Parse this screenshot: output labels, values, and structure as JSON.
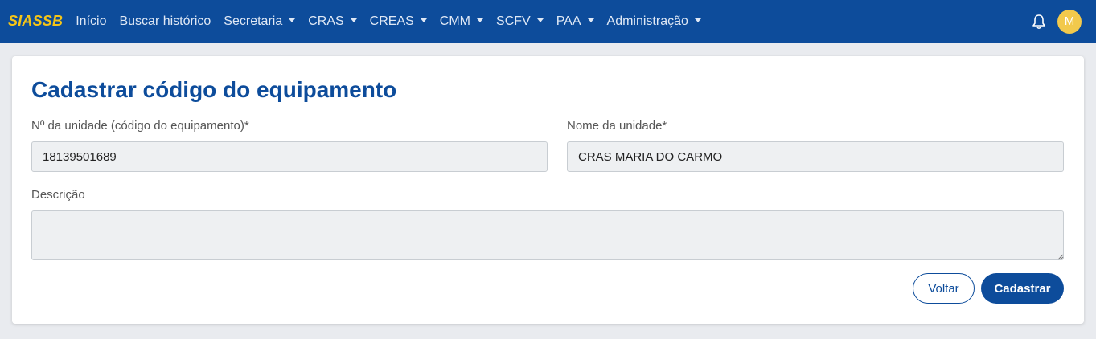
{
  "navbar": {
    "brand": "SIASSB",
    "items": [
      {
        "label": "Início",
        "dropdown": false
      },
      {
        "label": "Buscar histórico",
        "dropdown": false
      },
      {
        "label": "Secretaria",
        "dropdown": true
      },
      {
        "label": "CRAS",
        "dropdown": true
      },
      {
        "label": "CREAS",
        "dropdown": true
      },
      {
        "label": "CMM",
        "dropdown": true
      },
      {
        "label": "SCFV",
        "dropdown": true
      },
      {
        "label": "PAA",
        "dropdown": true
      },
      {
        "label": "Administração",
        "dropdown": true
      }
    ],
    "notification_icon": "bell-icon",
    "avatar_initial": "M"
  },
  "form": {
    "title": "Cadastrar código do equipamento",
    "codigo_label": "Nº da unidade (código do equipamento)*",
    "codigo_value": "18139501689",
    "nome_label": "Nome da unidade*",
    "nome_value": "CRAS MARIA DO CARMO",
    "descricao_label": "Descrição",
    "descricao_value": "",
    "voltar_label": "Voltar",
    "cadastrar_label": "Cadastrar"
  },
  "colors": {
    "primary": "#0d4c9b",
    "brand": "#f5c518",
    "avatar": "#f2c94c"
  }
}
